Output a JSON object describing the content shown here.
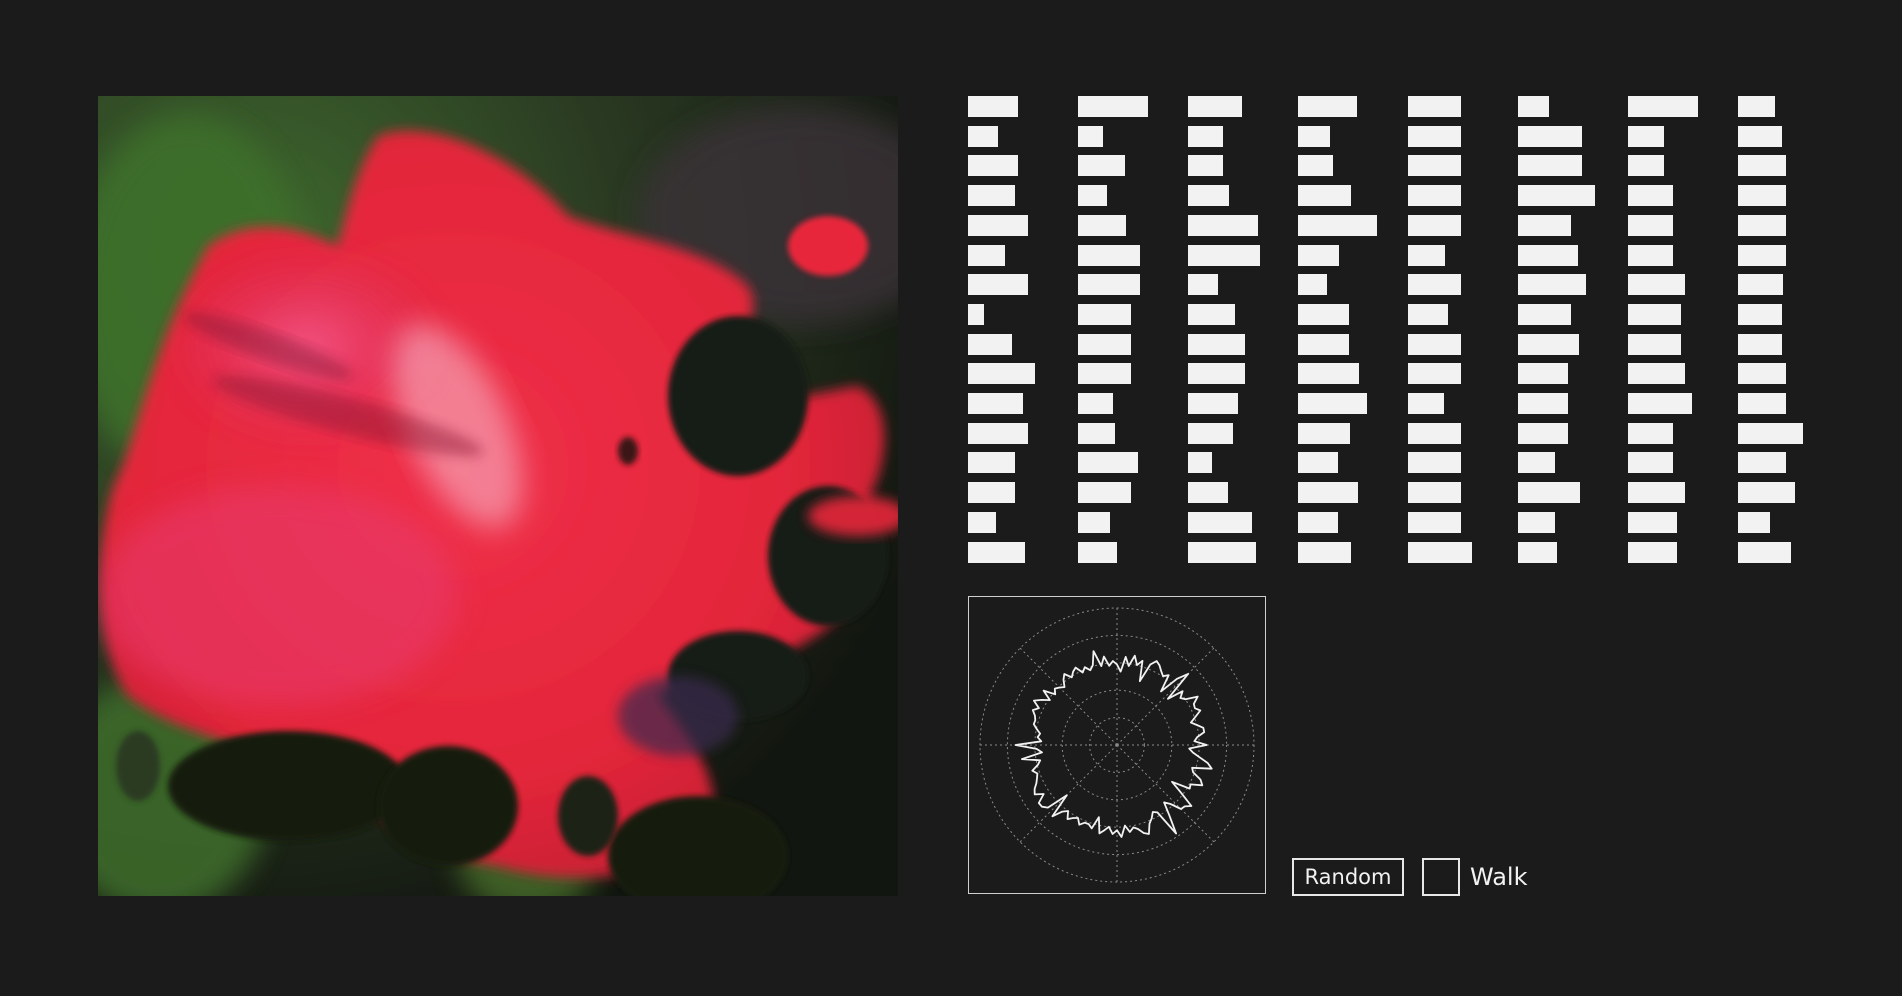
{
  "generated_image": {
    "subject": "flower",
    "colors": {
      "petal": "#e8263a",
      "petal_highlight": "#f25a8a",
      "foliage": "#3e6a2c",
      "shadow": "#141a10"
    }
  },
  "latent_sliders": {
    "columns": 8,
    "rows": 16,
    "values": [
      [
        0.5,
        0.3,
        0.5,
        0.47,
        0.6,
        0.37,
        0.6,
        0.16,
        0.44,
        0.67,
        0.55,
        0.6,
        0.47,
        0.47,
        0.28,
        0.57
      ],
      [
        0.7,
        0.25,
        0.47,
        0.29,
        0.48,
        0.62,
        0.62,
        0.53,
        0.53,
        0.53,
        0.35,
        0.37,
        0.6,
        0.53,
        0.32,
        0.39
      ],
      [
        0.54,
        0.35,
        0.35,
        0.41,
        0.7,
        0.72,
        0.3,
        0.47,
        0.57,
        0.57,
        0.5,
        0.45,
        0.24,
        0.4,
        0.64,
        0.68
      ],
      [
        0.59,
        0.32,
        0.35,
        0.53,
        0.79,
        0.41,
        0.29,
        0.51,
        0.51,
        0.61,
        0.69,
        0.52,
        0.4,
        0.6,
        0.4,
        0.53
      ],
      [
        0.53,
        0.53,
        0.53,
        0.53,
        0.53,
        0.37,
        0.53,
        0.4,
        0.53,
        0.53,
        0.36,
        0.53,
        0.53,
        0.53,
        0.53,
        0.64
      ],
      [
        0.31,
        0.64,
        0.64,
        0.77,
        0.53,
        0.6,
        0.68,
        0.53,
        0.61,
        0.5,
        0.5,
        0.5,
        0.37,
        0.62,
        0.37,
        0.39
      ],
      [
        0.7,
        0.36,
        0.36,
        0.45,
        0.45,
        0.45,
        0.57,
        0.53,
        0.53,
        0.57,
        0.64,
        0.45,
        0.45,
        0.57,
        0.49,
        0.49
      ],
      [
        0.37,
        0.44,
        0.48,
        0.48,
        0.48,
        0.48,
        0.45,
        0.44,
        0.44,
        0.48,
        0.48,
        0.65,
        0.48,
        0.57,
        0.32,
        0.53
      ]
    ]
  },
  "radar": {
    "rings": 5,
    "spokes": 8,
    "samples": 128
  },
  "controls": {
    "random_label": "Random",
    "walk_label": "Walk",
    "walk_checked": false
  }
}
